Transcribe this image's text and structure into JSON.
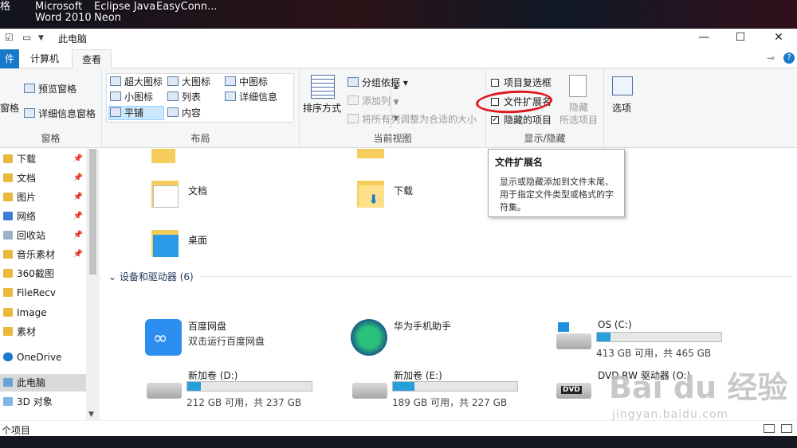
{
  "desktop": {
    "icons": [
      {
        "label": "格"
      },
      {
        "label": "Microsoft\nWord 2010"
      },
      {
        "label": "Eclipse Java\nNeon"
      },
      {
        "label": "EasyConn..."
      }
    ]
  },
  "window": {
    "title": "此电脑",
    "controls": {
      "minimize": "—",
      "maximize": "☐",
      "close": "✕"
    }
  },
  "tabs": {
    "file": "件",
    "computer": "计算机",
    "view": "查看"
  },
  "ribbon": {
    "panes": {
      "label": "窗格",
      "nav_pane": "窗格",
      "preview_pane": "预览窗格",
      "details_pane": "详细信息窗格"
    },
    "layout": {
      "label": "布局",
      "extra_large": "超大图标",
      "large": "大图标",
      "medium": "中图标",
      "small": "小图标",
      "list": "列表",
      "details": "详细信息",
      "tiles": "平铺",
      "content": "内容"
    },
    "current_view": {
      "label": "当前视图",
      "sort_by": "排序方式",
      "group_by": "分组依据",
      "add_columns": "添加列",
      "size_all_columns": "将所有列调整为合适的大小"
    },
    "show_hide": {
      "label": "显示/隐藏",
      "item_checkboxes": "项目复选框",
      "file_extensions": "文件扩展名",
      "hidden_items": "隐藏的项目",
      "hide_selected_1": "隐藏",
      "hide_selected_2": "所选项目",
      "item_checkboxes_checked": false,
      "file_extensions_checked": false,
      "hidden_items_checked": true
    },
    "options": "选项"
  },
  "tooltip": {
    "title": "文件扩展名",
    "body": "显示或隐藏添加到文件末尾、用于指定文件类型或格式的字符集。"
  },
  "nav": {
    "items": [
      {
        "label": "下载",
        "pinned": "📌"
      },
      {
        "label": "文档",
        "pinned": "📌"
      },
      {
        "label": "图片",
        "pinned": "📌"
      },
      {
        "label": "网络",
        "pinned": "📌"
      },
      {
        "label": "回收站",
        "pinned": "📌"
      },
      {
        "label": "音乐素材",
        "pinned": "📌"
      },
      {
        "label": "360截图"
      },
      {
        "label": "FileRecv"
      },
      {
        "label": "Image"
      },
      {
        "label": "素材"
      },
      {
        "label": "OneDrive"
      },
      {
        "label": "此电脑"
      },
      {
        "label": "3D 对象"
      }
    ]
  },
  "content": {
    "folders": [
      {
        "name": "文档"
      },
      {
        "name": "下载"
      },
      {
        "name": "桌面"
      }
    ],
    "devices_header": "设备和驱动器 (6)",
    "devices": [
      {
        "name": "百度网盘",
        "sub": "双击运行百度网盘"
      },
      {
        "name": "华为手机助手"
      },
      {
        "name": "OS (C:)",
        "space": "413 GB 可用，共 465 GB",
        "used_fraction": 0.11
      },
      {
        "name": "新加卷 (D:)",
        "space": "212 GB 可用，共 237 GB",
        "used_fraction": 0.11
      },
      {
        "name": "新加卷 (E:)",
        "space": "189 GB 可用，共 227 GB",
        "used_fraction": 0.17
      },
      {
        "name": "DVD RW 驱动器 (O:)"
      }
    ]
  },
  "status": {
    "text": "个项目"
  },
  "watermark": {
    "main": "Bai du 经验",
    "sub": "jingyan.baidu.com"
  },
  "colors": {
    "accent": "#1979ca",
    "annotation": "#e0171e",
    "drive_bar": "#26a0da"
  }
}
